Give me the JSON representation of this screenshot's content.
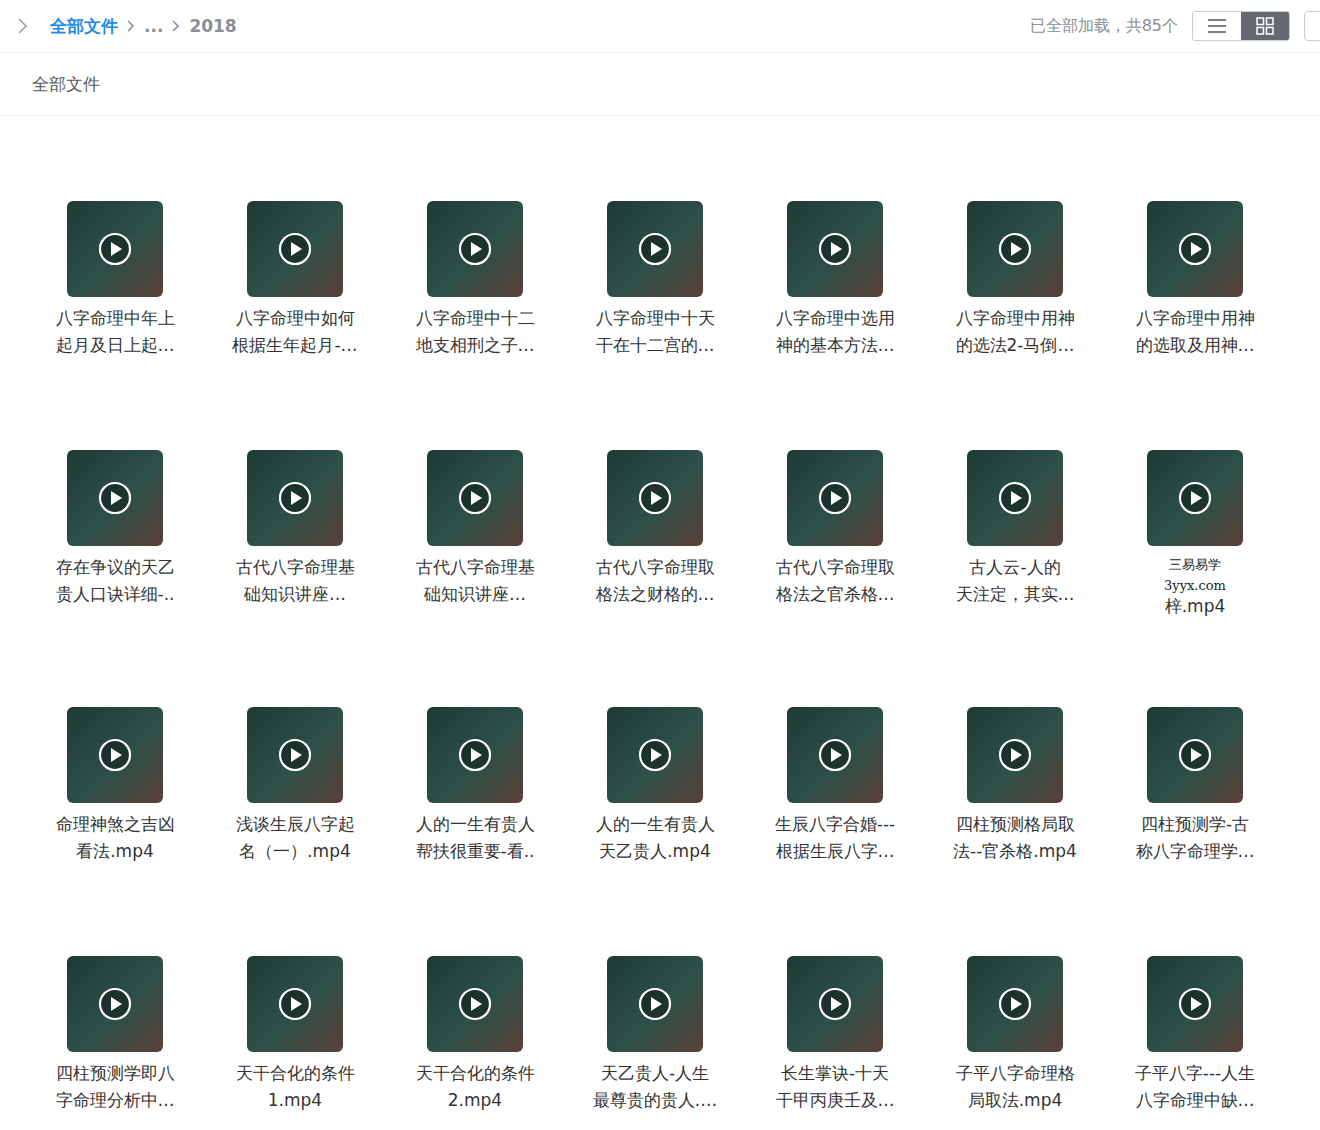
{
  "breadcrumb": {
    "path": [
      "全部文件",
      "...",
      "2018"
    ]
  },
  "status": "已全部加载，共85个",
  "view_modes": [
    {
      "kind": "list",
      "selected": false
    },
    {
      "kind": "grid",
      "selected": true
    }
  ],
  "subheader": "全部文件",
  "files": [
    {
      "lines": [
        "八字命理中年上",
        "起月及日上起…"
      ]
    },
    {
      "lines": [
        "八字命理中如何",
        "根据生年起月-…"
      ]
    },
    {
      "lines": [
        "八字命理中十二",
        "地支相刑之子…"
      ]
    },
    {
      "lines": [
        "八字命理中十天",
        "干在十二宫的…"
      ]
    },
    {
      "lines": [
        "八字命理中选用",
        "神的基本方法…"
      ]
    },
    {
      "lines": [
        "八字命理中用神",
        "的选法2-马倒…"
      ]
    },
    {
      "lines": [
        "八字命理中用神",
        "的选取及用神…"
      ]
    },
    {
      "lines": [
        "存在争议的天乙",
        "贵人口诀详细-.."
      ]
    },
    {
      "lines": [
        "古代八字命理基",
        "础知识讲座…"
      ]
    },
    {
      "lines": [
        "古代八字命理基",
        "础知识讲座…"
      ]
    },
    {
      "lines": [
        "古代八字命理取",
        "格法之财格的…"
      ]
    },
    {
      "lines": [
        "古代八字命理取",
        "格法之官杀格…"
      ]
    },
    {
      "lines": [
        "古人云-人的",
        "天注定，其实…"
      ]
    },
    {
      "lines": [
        "梓.mp4"
      ],
      "watermark": [
        "三易易学",
        "3yyx.com"
      ]
    },
    {
      "lines": [
        "命理神煞之吉凶",
        "看法.mp4"
      ]
    },
    {
      "lines": [
        "浅谈生辰八字起",
        "名（一）.mp4"
      ]
    },
    {
      "lines": [
        "人的一生有贵人",
        "帮扶很重要-看.."
      ]
    },
    {
      "lines": [
        "人的一生有贵人",
        "天乙贵人.mp4"
      ]
    },
    {
      "lines": [
        "生辰八字合婚---",
        "根据生辰八字…"
      ]
    },
    {
      "lines": [
        "四柱预测格局取",
        "法--官杀格.mp4"
      ]
    },
    {
      "lines": [
        "四柱预测学-古",
        "称八字命理学…"
      ]
    },
    {
      "lines": [
        "四柱预测学即八",
        "字命理分析中…"
      ]
    },
    {
      "lines": [
        "天干合化的条件",
        "1.mp4"
      ]
    },
    {
      "lines": [
        "天干合化的条件",
        "2.mp4"
      ]
    },
    {
      "lines": [
        "天乙贵人-人生",
        "最尊贵的贵人.…"
      ]
    },
    {
      "lines": [
        "长生掌诀-十天",
        "干甲丙庚壬及…"
      ]
    },
    {
      "lines": [
        "子平八字命理格",
        "局取法.mp4"
      ]
    },
    {
      "lines": [
        "子平八字---人生",
        "八字命理中缺…"
      ]
    }
  ]
}
